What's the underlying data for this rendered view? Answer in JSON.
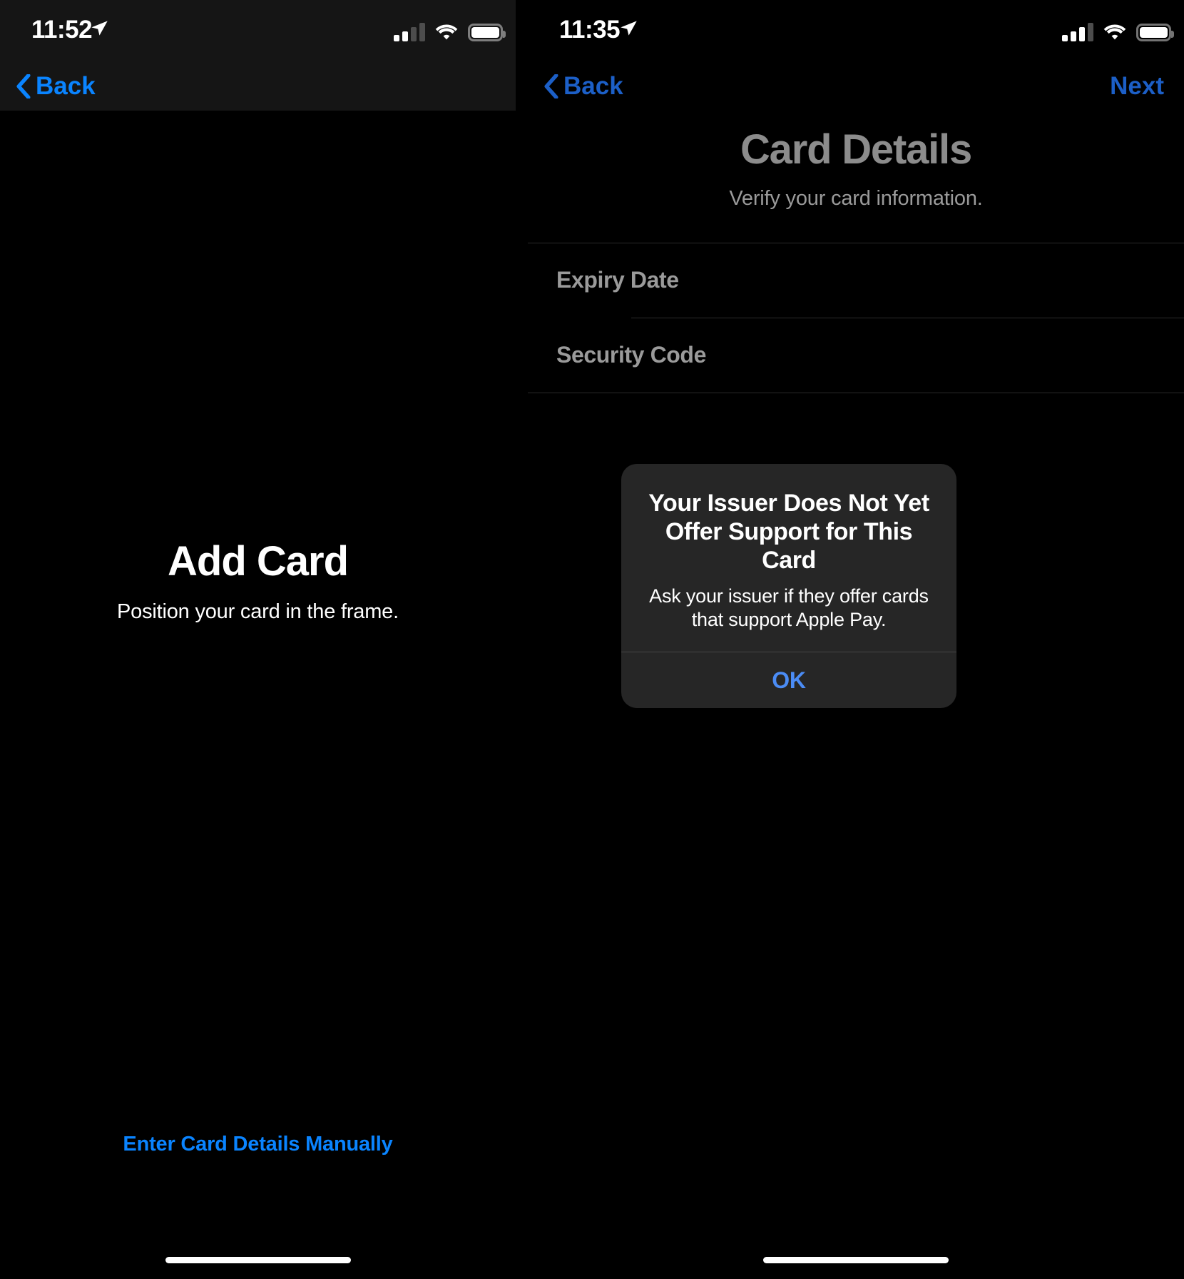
{
  "colors": {
    "accent_blue": "#0a84ff",
    "alert_blue": "#4b8cf5",
    "nav_blue_right": "#1c5fc7",
    "gray_label": "#9a9a9a",
    "alert_bg": "#262626",
    "chrome_bg": "#151515",
    "screen_bg": "#000000"
  },
  "left_screen": {
    "status_bar": {
      "time": "11:52",
      "location_icon": "location-arrow-icon",
      "signal_icon": "cellular-signal-icon",
      "signal_bars_filled": 2,
      "signal_bars_total": 4,
      "wifi_icon": "wifi-icon",
      "battery_icon": "battery-icon"
    },
    "nav": {
      "back_label": "Back",
      "back_icon": "chevron-left-icon"
    },
    "title": "Add Card",
    "subtitle": "Position your card in the frame.",
    "manual_entry_link": "Enter Card Details Manually",
    "home_indicator": "home-indicator"
  },
  "right_screen": {
    "status_bar": {
      "time": "11:35",
      "location_icon": "location-arrow-icon",
      "signal_icon": "cellular-signal-icon",
      "signal_bars_filled": 3,
      "signal_bars_total": 4,
      "wifi_icon": "wifi-icon",
      "battery_icon": "battery-icon"
    },
    "nav": {
      "back_label": "Back",
      "back_icon": "chevron-left-icon",
      "next_label": "Next"
    },
    "title": "Card Details",
    "subtitle": "Verify your card information.",
    "form_rows": [
      {
        "label": "Expiry Date",
        "value": ""
      },
      {
        "label": "Security Code",
        "value": ""
      }
    ],
    "alert": {
      "title": "Your Issuer Does Not Yet Offer Support for This Card",
      "message": "Ask your issuer if they offer cards that support Apple Pay.",
      "ok_label": "OK"
    },
    "home_indicator": "home-indicator"
  }
}
